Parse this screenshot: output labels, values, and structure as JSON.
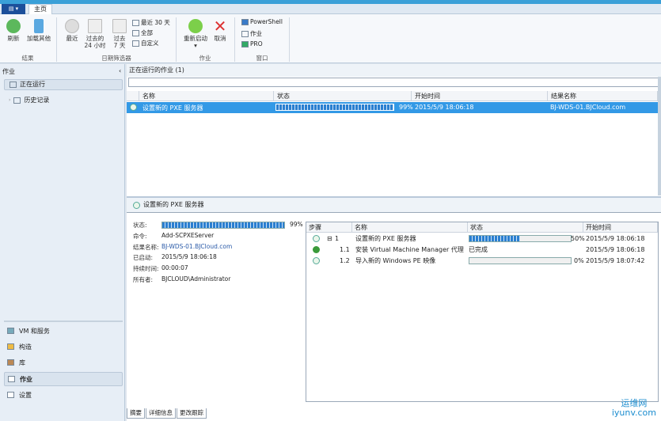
{
  "ribbon": {
    "app_menu": "▤ ▾",
    "tab_home": "主页",
    "buttons": {
      "refresh": "刷新",
      "load_more": "加载其他",
      "recent": "最近",
      "past24_1": "过去的",
      "past24_2": "24 小时",
      "past7_1": "过去",
      "past7_2": "7 天",
      "last30": "最近 30 天",
      "all": "全部",
      "custom": "自定义",
      "restart": "重新启动",
      "cancel": "取消",
      "powershell": "PowerShell",
      "jobs": "作业",
      "pro": "PRO"
    },
    "groups": {
      "results": "结果",
      "date_filter": "日期筛选器",
      "job": "作业",
      "window": "窗口"
    }
  },
  "left": {
    "title": "作业",
    "collapse": "‹",
    "items": [
      {
        "label": "正在运行"
      },
      {
        "label": "历史记录"
      }
    ],
    "workspaces": [
      {
        "label": "VM 和服务"
      },
      {
        "label": "构造"
      },
      {
        "label": "库"
      },
      {
        "label": "作业"
      },
      {
        "label": "设置"
      }
    ]
  },
  "main": {
    "title": "正在运行的作业 (1)",
    "search_value": "",
    "columns": [
      "名称",
      "状态",
      "开始时间",
      "结果名称"
    ],
    "rows": [
      {
        "name": "设置新的 PXE 服务器",
        "progress": 99,
        "progress_label": "99%",
        "start": "2015/5/9 18:06:18",
        "result": "BJ-WDS-01.BJCloud.com"
      }
    ]
  },
  "detail": {
    "title": "设置新的 PXE 服务器",
    "fields": {
      "status_label": "状态:",
      "status_progress": 99,
      "status_pct": "99%",
      "command_label": "命令:",
      "command": "Add-SCPXEServer",
      "result_label": "结果名称:",
      "result": "BJ-WDS-01.BJCloud.com",
      "started_label": "已启动:",
      "started": "2015/5/9 18:06:18",
      "duration_label": "持续时间:",
      "duration": "00:00:07",
      "owner_label": "所有者:",
      "owner": "BJCLOUD\\Administrator"
    },
    "step_columns": [
      "步骤",
      "名称",
      "状态",
      "开始时间"
    ],
    "steps": [
      {
        "step": "1",
        "name": "设置新的 PXE 服务器",
        "progress": 50,
        "status": "50%",
        "start": "2015/5/9 18:06:18"
      },
      {
        "step": "1.1",
        "name": "安装 Virtual Machine Manager 代理",
        "status": "已完成",
        "start": "2015/5/9 18:06:18"
      },
      {
        "step": "1.2",
        "name": "导入新的 Windows PE 映像",
        "progress": 0,
        "status": "0%",
        "start": "2015/5/9 18:07:42"
      }
    ],
    "tabs": [
      "摘要",
      "详细信息",
      "更改跟踪"
    ]
  },
  "watermark": {
    "line1": "运维网",
    "line2": "iyunv.com"
  }
}
